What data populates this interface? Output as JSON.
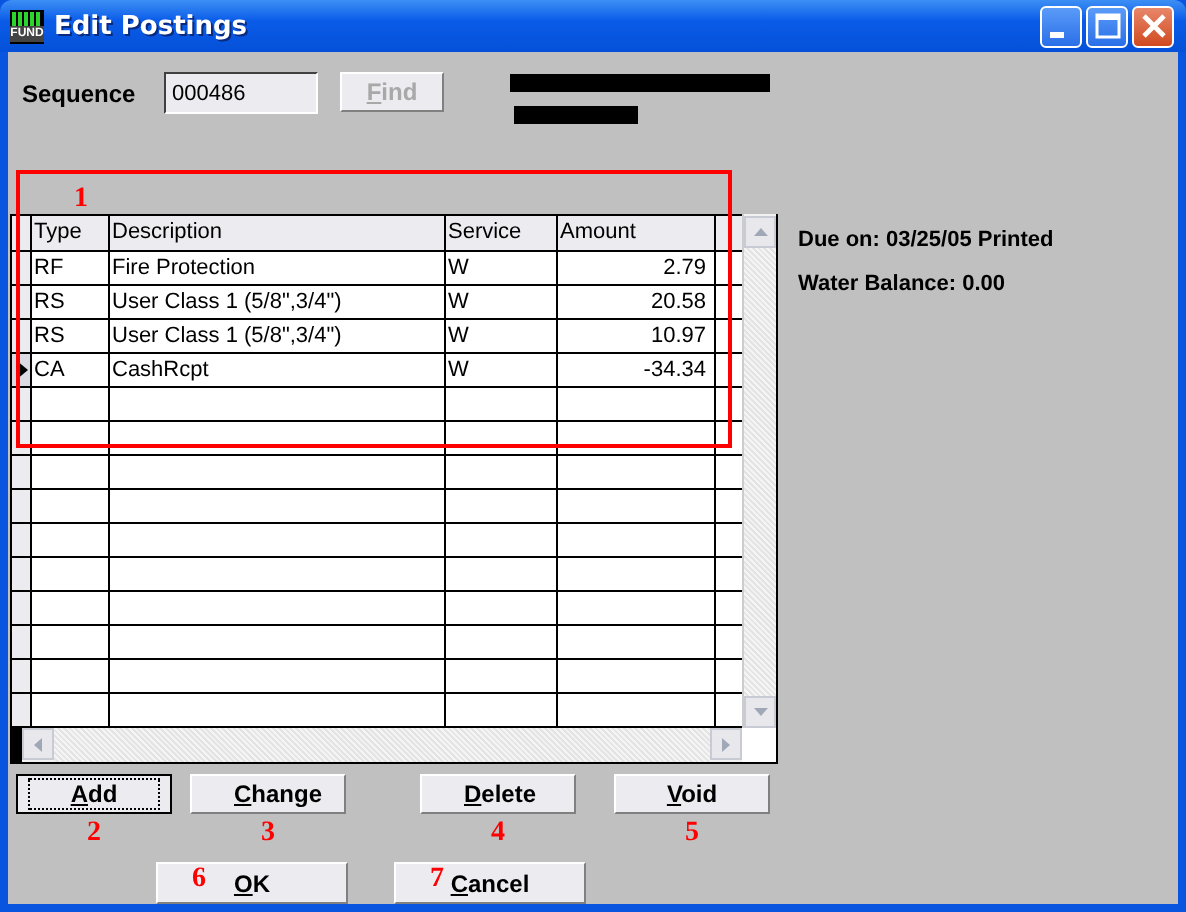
{
  "window": {
    "title": "Edit Postings",
    "icon_text": "FUND"
  },
  "sequence": {
    "label": "Sequence",
    "value": "000486",
    "find_button": {
      "label": "Find",
      "disabled": true
    }
  },
  "table": {
    "callout": "1",
    "columns": [
      "Type",
      "Description",
      "Service",
      "Amount"
    ],
    "rows": [
      {
        "cells": [
          "RF",
          "Fire Protection",
          "W",
          "2.79"
        ],
        "current": false
      },
      {
        "cells": [
          "RS",
          "User Class 1 (5/8\",3/4\")",
          "W",
          "20.58"
        ],
        "current": false
      },
      {
        "cells": [
          "RS",
          "User Class 1 (5/8\",3/4\")",
          "W",
          "10.97"
        ],
        "current": false
      },
      {
        "cells": [
          "CA",
          "CashRcpt",
          "W",
          "-34.34"
        ],
        "current": true
      }
    ]
  },
  "info": [
    "Due on: 03/25/05 Printed",
    "Water Balance: 0.00"
  ],
  "action_buttons": [
    {
      "label": "Add",
      "callout": "2",
      "focused": true
    },
    {
      "label": "Change",
      "callout": "3",
      "focused": false
    },
    {
      "label": "Delete",
      "callout": "4",
      "focused": false
    },
    {
      "label": "Void",
      "callout": "5",
      "focused": false
    }
  ],
  "dialog_buttons": [
    {
      "label": "OK",
      "callout": "6"
    },
    {
      "label": "Cancel",
      "callout": "7"
    }
  ]
}
